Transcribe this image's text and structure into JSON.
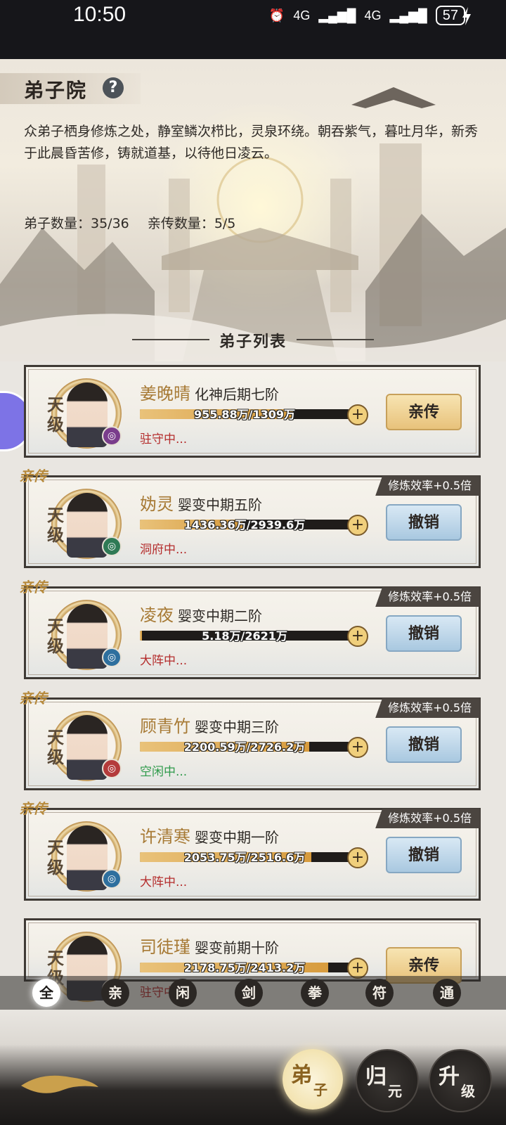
{
  "statusbar": {
    "time": "10:50",
    "signal1": "4G",
    "signal2": "4G",
    "battery": "57"
  },
  "page": {
    "title": "弟子院",
    "help": "?",
    "description": "众弟子栖身修炼之处，静室鳞次栉比，灵泉环绕。朝吞紫气，暮吐月华，新秀于此晨昏苦修，铸就道基，以待他日凌云。",
    "disciple_count": "弟子数量：35/36",
    "direct_count": "亲传数量：5/5",
    "list_header": "弟子列表"
  },
  "disciples": [
    {
      "grade": "天级",
      "name": "姜晚晴",
      "rank": "化神后期七阶",
      "progress": "955.88万/1309万",
      "progress_ratio": 0.73,
      "status": "驻守中...",
      "status_color": "#b42c2c",
      "button": "亲传",
      "button_style": "gold",
      "is_direct": false,
      "tag": "",
      "rate_tag": "",
      "element_color": "#7a3d8c",
      "element_icon": "water-swirl-icon"
    },
    {
      "grade": "天级",
      "name": "妫灵",
      "rank": "婴变中期五阶",
      "progress": "1436.36万/2939.6万",
      "progress_ratio": 0.49,
      "status": "洞府中...",
      "status_color": "#b42c2c",
      "button": "撤销",
      "button_style": "blue",
      "is_direct": true,
      "tag": "亲传",
      "rate_tag": "修炼效率+0.5倍",
      "element_color": "#2f7a55",
      "element_icon": "wind-swirl-icon"
    },
    {
      "grade": "天级",
      "name": "凌夜",
      "rank": "婴变中期二阶",
      "progress": "5.18万/2621万",
      "progress_ratio": 0.01,
      "status": "大阵中...",
      "status_color": "#b42c2c",
      "button": "撤销",
      "button_style": "blue",
      "is_direct": true,
      "tag": "亲传",
      "rate_tag": "修炼效率+0.5倍",
      "element_color": "#2e6f9e",
      "element_icon": "ice-crystal-icon"
    },
    {
      "grade": "天级",
      "name": "顾青竹",
      "rank": "婴变中期三阶",
      "progress": "2200.59万/2726.2万",
      "progress_ratio": 0.81,
      "status": "空闲中...",
      "status_color": "#2e9a4a",
      "button": "撤销",
      "button_style": "blue",
      "is_direct": true,
      "tag": "亲传",
      "rate_tag": "修炼效率+0.5倍",
      "element_color": "#b43b3b",
      "element_icon": "fire-icon"
    },
    {
      "grade": "天级",
      "name": "许清寒",
      "rank": "婴变中期一阶",
      "progress": "2053.75万/2516.6万",
      "progress_ratio": 0.82,
      "status": "大阵中...",
      "status_color": "#b42c2c",
      "button": "撤销",
      "button_style": "blue",
      "is_direct": true,
      "tag": "亲传",
      "rate_tag": "修炼效率+0.5倍",
      "element_color": "#2e6f9e",
      "element_icon": "ice-crystal-icon"
    },
    {
      "grade": "天级",
      "name": "司徒瑾",
      "rank": "婴变前期十阶",
      "progress": "2178.75万/2413.2万",
      "progress_ratio": 0.9,
      "status": "驻守中...",
      "status_color": "#b42c2c",
      "button": "亲传",
      "button_style": "gold",
      "is_direct": false,
      "tag": "",
      "rate_tag": "",
      "element_color": "#7a3d8c",
      "element_icon": "water-swirl-icon"
    }
  ],
  "filters": [
    "全",
    "亲",
    "闲",
    "剑",
    "拳",
    "符",
    "通"
  ],
  "active_filter": "全",
  "bottom_nav": [
    {
      "c1": "弟",
      "c2": "子",
      "active": true
    },
    {
      "c1": "归",
      "c2": "元",
      "active": false
    },
    {
      "c1": "升",
      "c2": "级",
      "active": false
    }
  ]
}
